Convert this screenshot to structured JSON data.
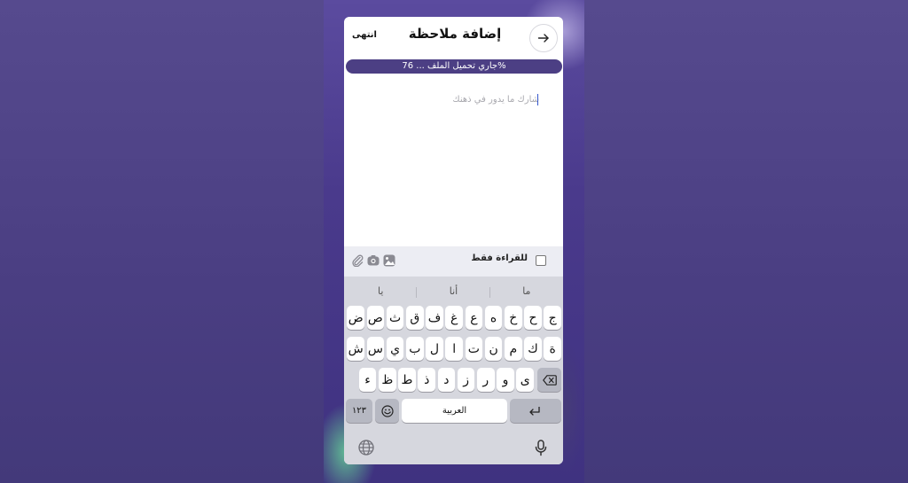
{
  "header": {
    "done_label": "انتهى",
    "title": "إضافة ملاحظة",
    "back_icon": "arrow-right-icon"
  },
  "upload": {
    "status_text": "جاري تحميل الملف ... 76%",
    "progress": 0.76
  },
  "editor": {
    "placeholder": "شارك ما يدور في ذهنك",
    "value": ""
  },
  "toolbar": {
    "readonly_label": "للقراءة فقط",
    "readonly_checked": false,
    "icons": [
      "image-icon",
      "camera-icon",
      "paperclip-icon"
    ]
  },
  "keyboard": {
    "suggestions": [
      "ما",
      "أنا",
      "يا"
    ],
    "row1": [
      "ج",
      "ح",
      "خ",
      "ه",
      "ع",
      "غ",
      "ف",
      "ق",
      "ث",
      "ص",
      "ض"
    ],
    "row2": [
      "ة",
      "ك",
      "م",
      "ن",
      "ت",
      "ا",
      "ل",
      "ب",
      "ي",
      "س",
      "ش"
    ],
    "row3": [
      "ى",
      "و",
      "ر",
      "ز",
      "د",
      "ذ",
      "ط",
      "ظ",
      "ء"
    ],
    "numbers_label": "١٢٣",
    "space_label": "العربية",
    "emoji_icon": "emoji-icon",
    "return_icon": "return-icon",
    "delete_icon": "delete-icon",
    "globe_icon": "globe-icon",
    "mic_icon": "microphone-icon"
  },
  "colors": {
    "accent": "#4c3f84",
    "background": "#4b4083"
  }
}
